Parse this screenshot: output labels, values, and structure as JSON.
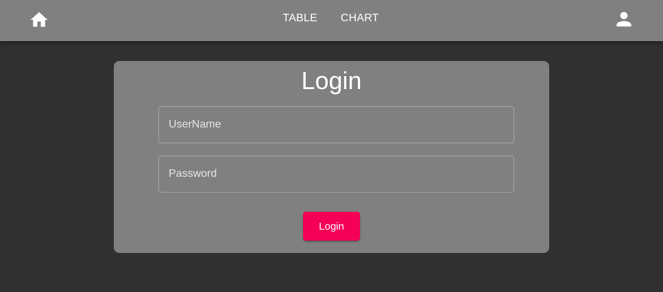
{
  "appbar": {
    "home_icon": "home-icon",
    "nav": [
      {
        "label": "TABLE"
      },
      {
        "label": "CHART"
      }
    ],
    "user_icon": "account-icon"
  },
  "login": {
    "title": "Login",
    "username_placeholder": "UserName",
    "username_value": "",
    "password_placeholder": "Password",
    "password_value": "",
    "button_label": "Login"
  },
  "colors": {
    "page_background": "#303030",
    "appbar_background": "#808080",
    "card_background": "#808080",
    "accent": "#f50057",
    "text": "#ffffff"
  }
}
